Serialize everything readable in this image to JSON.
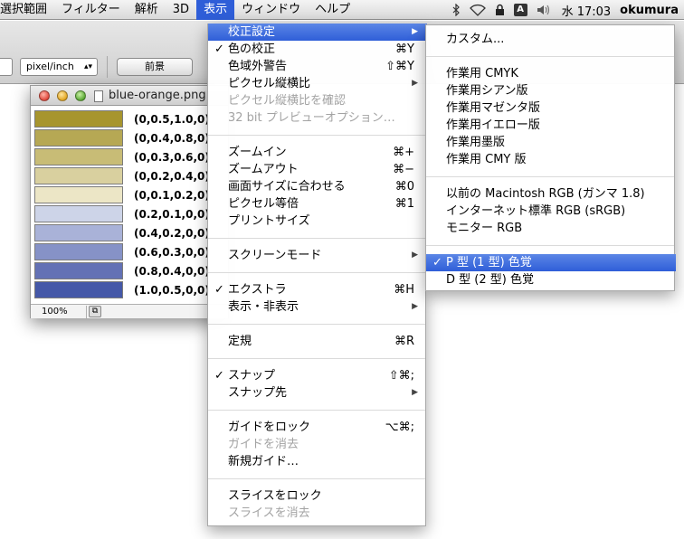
{
  "menubar": {
    "items": [
      "選択範囲",
      "フィルター",
      "解析",
      "3D",
      "表示",
      "ウィンドウ",
      "ヘルプ"
    ],
    "active_index": 4,
    "icons": [
      "bluetooth-icon",
      "wifi-icon",
      "lock-icon",
      "input-method-icon",
      "volume-icon"
    ],
    "input_method_glyph": "A",
    "clock": "水 17:03",
    "user": "okumura"
  },
  "toolbar": {
    "unit_select": "pixel/inch",
    "front_button": "前景"
  },
  "document": {
    "title": "blue-orange.png",
    "zoom": "100%",
    "swatches": [
      {
        "label": "(0,0.5,1.0,0)",
        "color": "#a7952e"
      },
      {
        "label": "(0,0.4,0.8,0)",
        "color": "#b6a854"
      },
      {
        "label": "(0,0.3,0.6,0)",
        "color": "#c8bc76"
      },
      {
        "label": "(0,0.2,0.4,0)",
        "color": "#d9d09f"
      },
      {
        "label": "(0,0.1,0.2,0)",
        "color": "#ece6c6"
      },
      {
        "label": "(0.2,0.1,0,0)",
        "color": "#cdd4e8"
      },
      {
        "label": "(0.4,0.2,0,0)",
        "color": "#a9b2d8"
      },
      {
        "label": "(0.6,0.3,0,0)",
        "color": "#8692c7"
      },
      {
        "label": "(0.8,0.4,0,0)",
        "color": "#6371b5"
      },
      {
        "label": "(1.0,0.5,0,0)",
        "color": "#4558a8"
      }
    ]
  },
  "view_menu": {
    "items": [
      {
        "label": "校正設定",
        "shortcut": "",
        "check": "",
        "submenu": true,
        "disabled": false,
        "highlight": true
      },
      {
        "label": "色の校正",
        "shortcut": "⌘Y",
        "check": "✓",
        "submenu": false,
        "disabled": false
      },
      {
        "label": "色域外警告",
        "shortcut": "⇧⌘Y",
        "check": "",
        "submenu": false,
        "disabled": false
      },
      {
        "label": "ピクセル縦横比",
        "shortcut": "",
        "check": "",
        "submenu": true,
        "disabled": false
      },
      {
        "label": "ピクセル縦横比を確認",
        "shortcut": "",
        "check": "",
        "submenu": false,
        "disabled": true
      },
      {
        "label": "32 bit プレビューオプション…",
        "shortcut": "",
        "check": "",
        "submenu": false,
        "disabled": true
      },
      {
        "label": "ズームイン",
        "shortcut": "⌘+",
        "check": "",
        "submenu": false,
        "disabled": false
      },
      {
        "label": "ズームアウト",
        "shortcut": "⌘−",
        "check": "",
        "submenu": false,
        "disabled": false
      },
      {
        "label": "画面サイズに合わせる",
        "shortcut": "⌘0",
        "check": "",
        "submenu": false,
        "disabled": false
      },
      {
        "label": "ピクセル等倍",
        "shortcut": "⌘1",
        "check": "",
        "submenu": false,
        "disabled": false
      },
      {
        "label": "プリントサイズ",
        "shortcut": "",
        "check": "",
        "submenu": false,
        "disabled": false
      },
      {
        "label": "スクリーンモード",
        "shortcut": "",
        "check": "",
        "submenu": true,
        "disabled": false
      },
      {
        "label": "エクストラ",
        "shortcut": "⌘H",
        "check": "✓",
        "submenu": false,
        "disabled": false
      },
      {
        "label": "表示・非表示",
        "shortcut": "",
        "check": "",
        "submenu": true,
        "disabled": false
      },
      {
        "label": "定規",
        "shortcut": "⌘R",
        "check": "",
        "submenu": false,
        "disabled": false
      },
      {
        "label": "スナップ",
        "shortcut": "⇧⌘;",
        "check": "✓",
        "submenu": false,
        "disabled": false
      },
      {
        "label": "スナップ先",
        "shortcut": "",
        "check": "",
        "submenu": true,
        "disabled": false
      },
      {
        "label": "ガイドをロック",
        "shortcut": "⌥⌘;",
        "check": "",
        "submenu": false,
        "disabled": false
      },
      {
        "label": "ガイドを消去",
        "shortcut": "",
        "check": "",
        "submenu": false,
        "disabled": true
      },
      {
        "label": "新規ガイド…",
        "shortcut": "",
        "check": "",
        "submenu": false,
        "disabled": false
      },
      {
        "label": "スライスをロック",
        "shortcut": "",
        "check": "",
        "submenu": false,
        "disabled": false
      },
      {
        "label": "スライスを消去",
        "shortcut": "",
        "check": "",
        "submenu": false,
        "disabled": true
      }
    ]
  },
  "proof_menu": {
    "items": [
      {
        "label": "カスタム...",
        "check": "",
        "highlight": false
      },
      {
        "label": "作業用 CMYK",
        "check": "",
        "highlight": false
      },
      {
        "label": "作業用シアン版",
        "check": "",
        "highlight": false
      },
      {
        "label": "作業用マゼンタ版",
        "check": "",
        "highlight": false
      },
      {
        "label": "作業用イエロー版",
        "check": "",
        "highlight": false
      },
      {
        "label": "作業用墨版",
        "check": "",
        "highlight": false
      },
      {
        "label": "作業用 CMY 版",
        "check": "",
        "highlight": false
      },
      {
        "label": "以前の Macintosh RGB (ガンマ 1.8)",
        "check": "",
        "highlight": false
      },
      {
        "label": "インターネット標準 RGB (sRGB)",
        "check": "",
        "highlight": false
      },
      {
        "label": "モニター RGB",
        "check": "",
        "highlight": false
      },
      {
        "label": "P 型 (1 型) 色覚",
        "check": "✓",
        "highlight": true
      },
      {
        "label": "D 型 (2 型) 色覚",
        "check": "",
        "highlight": false
      }
    ]
  }
}
